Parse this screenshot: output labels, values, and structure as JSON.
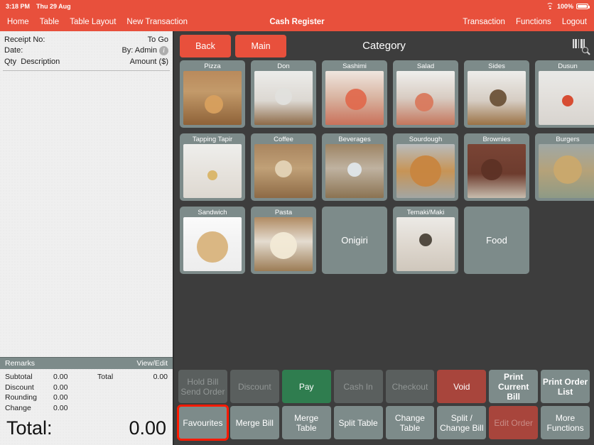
{
  "statusbar": {
    "time": "3:18 PM",
    "date": "Thu 29 Aug",
    "battery": "100%",
    "wifi_icon": "wifi-icon",
    "battery_icon": "battery-icon"
  },
  "navbar": {
    "title": "Cash Register",
    "left_items": [
      {
        "label": "Home"
      },
      {
        "label": "Table"
      },
      {
        "label": "Table Layout"
      },
      {
        "label": "New Transaction"
      }
    ],
    "right_items": [
      {
        "label": "Transaction"
      },
      {
        "label": "Functions"
      },
      {
        "label": "Logout"
      }
    ]
  },
  "receipt": {
    "receipt_no_label": "Receipt No:",
    "receipt_no_value": "",
    "to_go_label": "To Go",
    "date_label": "Date:",
    "date_value": "",
    "by_label": "By: Admin",
    "info_icon": "info-icon",
    "col_qty": "Qty",
    "col_description": "Description",
    "col_amount": "Amount ($)",
    "items": [],
    "remarks_label": "Remarks",
    "view_edit_label": "View/Edit",
    "totals": [
      {
        "label": "Subtotal",
        "value": "0.00"
      },
      {
        "label": "Discount",
        "value": "0.00"
      },
      {
        "label": "Rounding",
        "value": "0.00"
      },
      {
        "label": "Change",
        "value": "0.00"
      }
    ],
    "total_side_label": "Total",
    "total_side_value": "0.00",
    "grand_label": "Total:",
    "grand_value": "0.00"
  },
  "category": {
    "back_label": "Back",
    "main_label": "Main",
    "title": "Category",
    "scan_icon": "barcode-search-icon",
    "tiles": [
      [
        {
          "label": "Pizza",
          "has_image": true,
          "image": "pizza-photo"
        },
        {
          "label": "Don",
          "has_image": true,
          "image": "donburi-photo"
        },
        {
          "label": "Sashimi",
          "has_image": true,
          "image": "sashimi-photo"
        },
        {
          "label": "Salad",
          "has_image": true,
          "image": "salad-photo"
        },
        {
          "label": "Sides",
          "has_image": true,
          "image": "sides-photo"
        },
        {
          "label": "Dusun",
          "has_image": true,
          "image": "bottle-photo"
        }
      ],
      [
        {
          "label": "Tapping Tapir",
          "has_image": true,
          "image": "tapir-bottle-photo"
        },
        {
          "label": "Coffee",
          "has_image": true,
          "image": "latte-photo"
        },
        {
          "label": "Beverages",
          "has_image": true,
          "image": "iced-drink-photo"
        },
        {
          "label": "Sourdough",
          "has_image": true,
          "image": "sourdough-photo"
        },
        {
          "label": "Brownies",
          "has_image": true,
          "image": "brownies-photo"
        },
        {
          "label": "Burgers",
          "has_image": true,
          "image": "burger-photo"
        }
      ],
      [
        {
          "label": "Sandwich",
          "has_image": true,
          "image": "sandwich-photo"
        },
        {
          "label": "Pasta",
          "has_image": true,
          "image": "pasta-photo"
        },
        {
          "label": "Onigiri",
          "has_image": false,
          "image": ""
        },
        {
          "label": "Temaki/Maki",
          "has_image": true,
          "image": "temaki-photo"
        },
        {
          "label": "Food",
          "has_image": false,
          "image": ""
        }
      ]
    ]
  },
  "actions": {
    "row1": [
      {
        "label": "Hold Bill\nSend Order",
        "state": "disabled"
      },
      {
        "label": "Discount",
        "state": "disabled"
      },
      {
        "label": "Pay",
        "state": "green"
      },
      {
        "label": "Cash In",
        "state": "disabled"
      },
      {
        "label": "Checkout",
        "state": "disabled"
      },
      {
        "label": "Void",
        "state": "red"
      },
      {
        "label": "Print\nCurrent Bill",
        "state": "enabled"
      },
      {
        "label": "Print Order\nList",
        "state": "enabled"
      }
    ],
    "row2": [
      {
        "label": "Favourites",
        "state": "plain",
        "highlighted": true
      },
      {
        "label": "Merge Bill",
        "state": "plain",
        "highlighted": false
      },
      {
        "label": "Merge Table",
        "state": "plain",
        "highlighted": false
      },
      {
        "label": "Split Table",
        "state": "plain",
        "highlighted": false
      },
      {
        "label": "Change\nTable",
        "state": "plain",
        "highlighted": false
      },
      {
        "label": "Split /\nChange Bill",
        "state": "plain",
        "highlighted": false
      },
      {
        "label": "Edit Order",
        "state": "reddis",
        "highlighted": false
      },
      {
        "label": "More\nFunctions",
        "state": "plain",
        "highlighted": false
      }
    ]
  },
  "colors": {
    "brand_red": "#e8503c",
    "panel_gray": "#7d8b8a",
    "background": "#3d3d3d",
    "pay_green": "#2f7d4f",
    "void_red": "#a8453c",
    "highlight": "#ff1a00"
  }
}
